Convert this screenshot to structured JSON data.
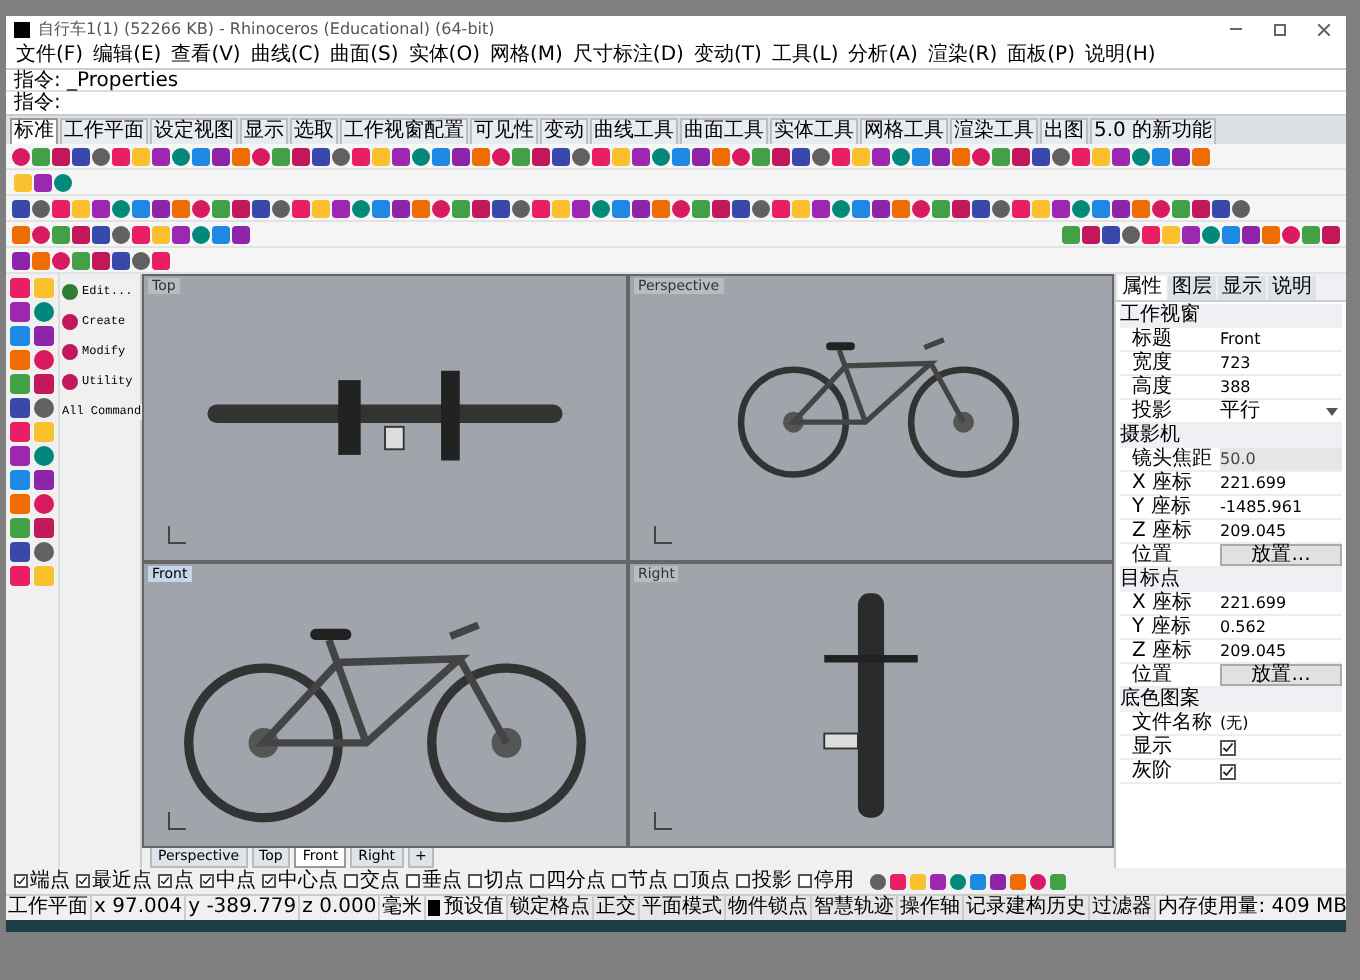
{
  "window": {
    "title": "自行车1(1) (52266 KB) - Rhinoceros (Educational) (64-bit)"
  },
  "menu": [
    "文件(F)",
    "编辑(E)",
    "查看(V)",
    "曲线(C)",
    "曲面(S)",
    "实体(O)",
    "网格(M)",
    "尺寸标注(D)",
    "变动(T)",
    "工具(L)",
    "分析(A)",
    "渲染(R)",
    "面板(P)",
    "说明(H)"
  ],
  "command_history": "指令: _Properties",
  "command_prompt": "指令:",
  "toolbar_tabs": [
    {
      "label": "标准",
      "selected": true
    },
    {
      "label": "工作平面",
      "selected": false
    },
    {
      "label": "设定视图",
      "selected": false
    },
    {
      "label": "显示",
      "selected": false
    },
    {
      "label": "选取",
      "selected": false
    },
    {
      "label": "工作视窗配置",
      "selected": false
    },
    {
      "label": "可见性",
      "selected": false
    },
    {
      "label": "变动",
      "selected": false
    },
    {
      "label": "曲线工具",
      "selected": false
    },
    {
      "label": "曲面工具",
      "selected": false
    },
    {
      "label": "实体工具",
      "selected": false
    },
    {
      "label": "网格工具",
      "selected": false
    },
    {
      "label": "渲染工具",
      "selected": false
    },
    {
      "label": "出图",
      "selected": false
    },
    {
      "label": "5.0 的新功能",
      "selected": false
    }
  ],
  "macro_buttons": [
    "Edit...",
    "Create",
    "Modify",
    "Utility",
    "All Command"
  ],
  "viewports": [
    {
      "title": "Top",
      "kind": "top",
      "selected": false
    },
    {
      "title": "Perspective",
      "kind": "perspective",
      "selected": false
    },
    {
      "title": "Front",
      "kind": "front",
      "selected": true
    },
    {
      "title": "Right",
      "kind": "right",
      "selected": false
    }
  ],
  "viewport_tabs": [
    {
      "label": "Perspective",
      "selected": false
    },
    {
      "label": "Top",
      "selected": false
    },
    {
      "label": "Front",
      "selected": true
    },
    {
      "label": "Right",
      "selected": false
    },
    {
      "label": "+",
      "selected": false
    }
  ],
  "properties_panel": {
    "tabs": [
      {
        "label": "属性",
        "selected": true
      },
      {
        "label": "图层",
        "selected": false
      },
      {
        "label": "显示",
        "selected": false
      },
      {
        "label": "说明",
        "selected": false
      }
    ],
    "sections": [
      {
        "title": "工作视窗",
        "rows": [
          {
            "label": "标题",
            "value": "Front",
            "kind": "text"
          },
          {
            "label": "宽度",
            "value": "723",
            "kind": "text"
          },
          {
            "label": "高度",
            "value": "388",
            "kind": "text"
          },
          {
            "label": "投影",
            "value": "平行",
            "kind": "dropdown"
          }
        ]
      },
      {
        "title": "摄影机",
        "rows": [
          {
            "label": "镜头焦距",
            "value": "50.0",
            "kind": "disabled"
          },
          {
            "label": "X 座标",
            "value": "221.699",
            "kind": "text"
          },
          {
            "label": "Y 座标",
            "value": "-1485.961",
            "kind": "text"
          },
          {
            "label": "Z 座标",
            "value": "209.045",
            "kind": "text"
          },
          {
            "label": "位置",
            "value": "放置...",
            "kind": "button"
          }
        ]
      },
      {
        "title": "目标点",
        "rows": [
          {
            "label": "X 座标",
            "value": "221.699",
            "kind": "text"
          },
          {
            "label": "Y 座标",
            "value": "0.562",
            "kind": "text"
          },
          {
            "label": "Z 座标",
            "value": "209.045",
            "kind": "text"
          },
          {
            "label": "位置",
            "value": "放置...",
            "kind": "button"
          }
        ]
      },
      {
        "title": "底色图案",
        "rows": [
          {
            "label": "文件名称",
            "value": "(无)",
            "kind": "text"
          },
          {
            "label": "显示",
            "checked": true,
            "kind": "checkbox"
          },
          {
            "label": "灰阶",
            "checked": true,
            "kind": "checkbox"
          }
        ]
      }
    ]
  },
  "osnaps": [
    {
      "label": "端点",
      "checked": true
    },
    {
      "label": "最近点",
      "checked": true
    },
    {
      "label": "点",
      "checked": true
    },
    {
      "label": "中点",
      "checked": true
    },
    {
      "label": "中心点",
      "checked": true
    },
    {
      "label": "交点",
      "checked": false
    },
    {
      "label": "垂点",
      "checked": false
    },
    {
      "label": "切点",
      "checked": false
    },
    {
      "label": "四分点",
      "checked": false
    },
    {
      "label": "节点",
      "checked": false
    },
    {
      "label": "顶点",
      "checked": false
    },
    {
      "label": "投影",
      "checked": false
    },
    {
      "label": "停用",
      "checked": false
    }
  ],
  "status_bar": [
    {
      "text": "工作平面",
      "kind": "plain"
    },
    {
      "text": "x 97.004",
      "kind": "plain"
    },
    {
      "text": "y -389.779",
      "kind": "plain"
    },
    {
      "text": "z 0.000",
      "kind": "plain"
    },
    {
      "text": "毫米",
      "kind": "plain"
    },
    {
      "text": "预设值",
      "kind": "layer"
    },
    {
      "text": "锁定格点",
      "kind": "toggle"
    },
    {
      "text": "正交",
      "kind": "toggle"
    },
    {
      "text": "平面模式",
      "kind": "toggle"
    },
    {
      "text": "物件锁点",
      "kind": "toggle"
    },
    {
      "text": "智慧轨迹",
      "kind": "toggle"
    },
    {
      "text": "操作轴",
      "kind": "toggle"
    },
    {
      "text": "记录建构历史",
      "kind": "toggle"
    },
    {
      "text": "过滤器",
      "kind": "toggle"
    },
    {
      "text": "内存使用量: 409 MB",
      "kind": "plain"
    }
  ]
}
